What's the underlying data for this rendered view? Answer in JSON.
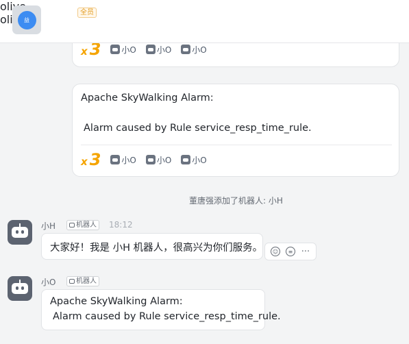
{
  "header": {
    "group_name": "olive",
    "member_badge": "全员",
    "subtitle": "olive"
  },
  "card_top": {
    "count_x": "x",
    "count_n": "3",
    "reactors": [
      "小O",
      "小O",
      "小O"
    ]
  },
  "card_alarm": {
    "line1": "Apache SkyWalking Alarm:",
    "line2": "Alarm caused by Rule service_resp_time_rule.",
    "count_x": "x",
    "count_n": "3",
    "reactors": [
      "小O",
      "小O",
      "小O"
    ]
  },
  "system_message": "董唐强添加了机器人: 小H",
  "message_h": {
    "sender": "小H",
    "tag": "机器人",
    "time": "18:12",
    "text": "大家好！我是 小H 机器人，很高兴为你们服务。",
    "actions": [
      "emoji-icon",
      "reply-icon",
      "more-icon"
    ],
    "more_label": "···"
  },
  "message_o": {
    "sender": "小O",
    "tag": "机器人",
    "line1": "Apache SkyWalking Alarm:",
    "line2": "Alarm caused by Rule service_resp_time_rule."
  },
  "colors": {
    "accent_count": "#f5a400",
    "bot_avatar": "#5c6370",
    "group_avatar_dot": "#3c8cf2"
  }
}
